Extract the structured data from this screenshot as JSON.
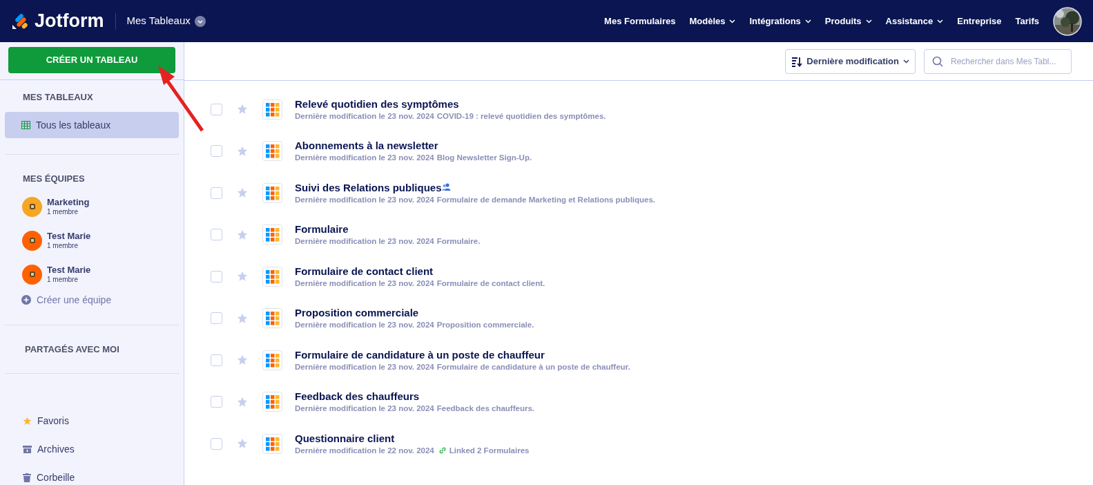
{
  "header": {
    "logo_text": "Jotform",
    "context": "Mes Tableaux",
    "nav": [
      {
        "label": "Mes Formulaires",
        "dropdown": false
      },
      {
        "label": "Modèles",
        "dropdown": true
      },
      {
        "label": "Intégrations",
        "dropdown": true
      },
      {
        "label": "Produits",
        "dropdown": true
      },
      {
        "label": "Assistance",
        "dropdown": true
      },
      {
        "label": "Entreprise",
        "dropdown": false
      },
      {
        "label": "Tarifs",
        "dropdown": false
      }
    ]
  },
  "sidebar": {
    "create_button": "CRÉER UN TABLEAU",
    "my_tables": {
      "heading": "MES TABLEAUX",
      "items": [
        {
          "label": "Tous les tableaux",
          "selected": true
        }
      ]
    },
    "teams": {
      "heading": "MES ÉQUIPES",
      "items": [
        {
          "name": "Marketing",
          "members": "1 membre",
          "color": "#f5a623"
        },
        {
          "name": "Test Marie",
          "members": "1 membre",
          "color": "#ff6100"
        },
        {
          "name": "Test Marie",
          "members": "1 membre",
          "color": "#ff6100"
        }
      ],
      "create": "Créer une équipe"
    },
    "shared_heading": "PARTAGÉS AVEC MOI",
    "bottom": [
      {
        "kind": "favorites",
        "label": "Favoris"
      },
      {
        "kind": "archive",
        "label": "Archives"
      },
      {
        "kind": "trash",
        "label": "Corbeille"
      }
    ]
  },
  "toolbar": {
    "sort": "Dernière modification",
    "search": {
      "placeholder": "Rechercher dans Mes Tabl..."
    }
  },
  "tables": [
    {
      "title": "Relevé quotidien des symptômes",
      "date": "Dernière modification le 23 nov. 2024",
      "kind": "description",
      "detail": "COVID-19 : relevé quotidien des symptômes.",
      "shared": false,
      "checked": false,
      "starred": false
    },
    {
      "title": "Abonnements à la newsletter",
      "date": "Dernière modification le 23 nov. 2024",
      "kind": "description",
      "detail": "Blog Newsletter Sign-Up.",
      "shared": false,
      "checked": false,
      "starred": false
    },
    {
      "title": "Suivi des Relations publiques",
      "date": "Dernière modification le 23 nov. 2024",
      "kind": "description",
      "detail": "Formulaire de demande Marketing et Relations publiques.",
      "shared": true,
      "checked": false,
      "starred": false
    },
    {
      "title": "Formulaire",
      "date": "Dernière modification le 23 nov. 2024",
      "kind": "description",
      "detail": "Formulaire.",
      "shared": false,
      "checked": false,
      "starred": false
    },
    {
      "title": "Formulaire de contact client",
      "date": "Dernière modification le 23 nov. 2024",
      "kind": "description",
      "detail": "Formulaire de contact client.",
      "shared": false,
      "checked": false,
      "starred": false
    },
    {
      "title": "Proposition commerciale",
      "date": "Dernière modification le 23 nov. 2024",
      "kind": "description",
      "detail": "Proposition commerciale.",
      "shared": false,
      "checked": false,
      "starred": false
    },
    {
      "title": "Formulaire de candidature à un poste de chauffeur",
      "date": "Dernière modification le 23 nov. 2024",
      "kind": "description",
      "detail": "Formulaire de candidature à un poste de chauffeur.",
      "shared": false,
      "checked": false,
      "starred": false
    },
    {
      "title": "Feedback des chauffeurs",
      "date": "Dernière modification le 23 nov. 2024",
      "kind": "description",
      "detail": "Feedback des chauffeurs.",
      "shared": false,
      "checked": false,
      "starred": false
    },
    {
      "title": "Questionnaire client",
      "date": "Dernière modification le 22 nov. 2024",
      "kind": "linked",
      "detail": "Linked **2** Formulaires",
      "shared": false,
      "checked": false,
      "starred": false
    }
  ]
}
